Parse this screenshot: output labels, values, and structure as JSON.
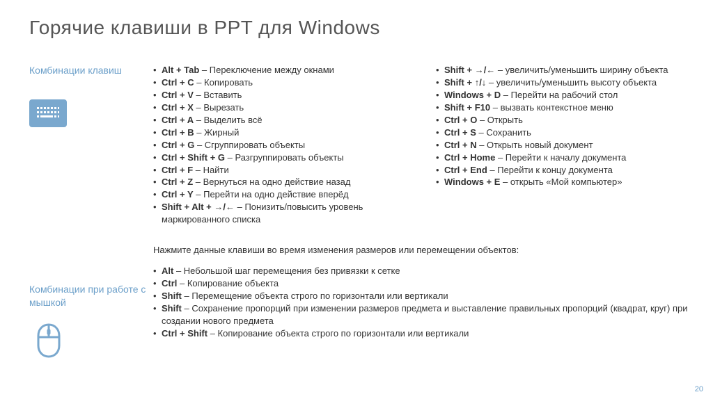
{
  "title": "Горячие клавиши в PPT для Windows",
  "side1": "Комбинации клавиш",
  "side2": "Комбинации при работе с мышкой",
  "col1": [
    {
      "key": "Alt + Tab",
      "desc": "Переключение между окнами"
    },
    {
      "key": "Ctrl + C",
      "desc": "Копировать"
    },
    {
      "key": "Ctrl + V",
      "desc": "Вставить"
    },
    {
      "key": "Ctrl + X",
      "desc": "Вырезать"
    },
    {
      "key": "Ctrl + A",
      "desc": "Выделить всё"
    },
    {
      "key": "Ctrl + B",
      "desc": "Жирный"
    },
    {
      "key": "Ctrl + G",
      "desc": "Сгруппировать объекты"
    },
    {
      "key": "Ctrl + Shift + G",
      "desc": "Разгруппировать объекты"
    },
    {
      "key": "Ctrl + F",
      "desc": "Найти"
    },
    {
      "key": "Ctrl + Z",
      "desc": "Вернуться на одно действие назад"
    },
    {
      "key": "Ctrl + Y",
      "desc": "Перейти на одно действие вперёд"
    },
    {
      "key": "Shift + Alt + →/←",
      "desc": "Понизить/повысить уровень маркированного списка"
    }
  ],
  "col2": [
    {
      "key": "Shift + →/←",
      "desc": "увеличить/уменьшить ширину объекта"
    },
    {
      "key": "Shift + ↑/↓",
      "desc": "увеличить/уменьшить высоту объекта"
    },
    {
      "key": "Windows + D",
      "desc": "Перейти на рабочий стол"
    },
    {
      "key": "Shift + F10",
      "desc": "вызвать контекстное меню"
    },
    {
      "key": "Ctrl + O",
      "desc": "Открыть"
    },
    {
      "key": "Ctrl + S",
      "desc": "Сохранить"
    },
    {
      "key": "Ctrl + N",
      "desc": "Открыть новый документ"
    },
    {
      "key": "Ctrl + Home",
      "desc": "Перейти к началу документа"
    },
    {
      "key": "Ctrl + End",
      "desc": "Перейти к концу документа"
    },
    {
      "key": "Windows + E",
      "desc": "открыть «Мой компьютер»"
    }
  ],
  "mouseIntro": "Нажмите данные клавиши во время изменения размеров или перемещении объектов:",
  "mouse": [
    {
      "key": "Alt",
      "desc": "Небольшой шаг перемещения без привязки к сетке"
    },
    {
      "key": "Ctrl",
      "desc": "Копирование объекта"
    },
    {
      "key": "Shift",
      "desc": "Перемещение объекта строго по горизонтали или вертикали"
    },
    {
      "key": "Shift",
      "desc": "Сохранение пропорций при изменении размеров предмета и выставление правильных пропорций (квадрат, круг) при создании нового предмета"
    },
    {
      "key": "Ctrl + Shift",
      "desc": "Копирование объекта строго по горизонтали или вертикали"
    }
  ],
  "pageNum": "20"
}
